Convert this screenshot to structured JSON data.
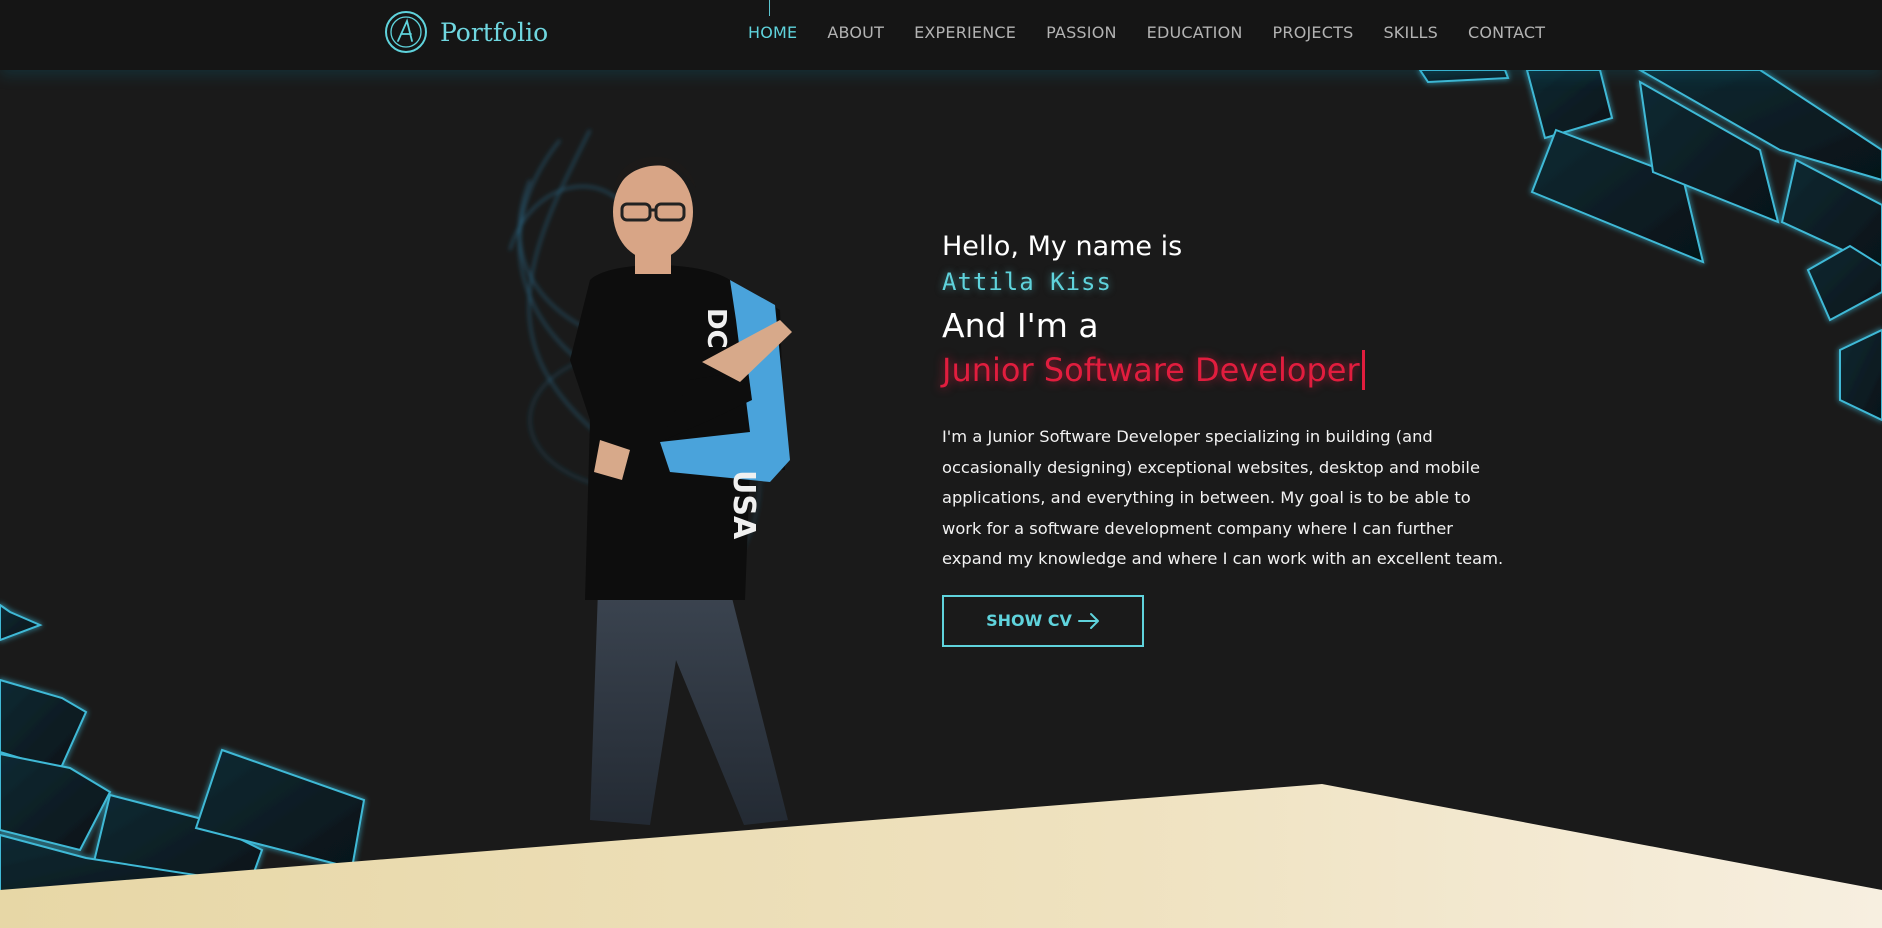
{
  "nav": {
    "logo_text": "Portfolio",
    "links": [
      {
        "label": "HOME",
        "active": true
      },
      {
        "label": "ABOUT"
      },
      {
        "label": "EXPERIENCE"
      },
      {
        "label": "PASSION"
      },
      {
        "label": "EDUCATION"
      },
      {
        "label": "PROJECTS"
      },
      {
        "label": "SKILLS"
      },
      {
        "label": "CONTACT"
      }
    ]
  },
  "hero": {
    "greeting": "Hello, My name is",
    "name": "Attila Kiss",
    "intro": "And I'm a",
    "role": "Junior Software Developer",
    "bio": "I'm a Junior Software Developer specializing in building (and occasionally designing) exceptional websites, desktop and mobile applications, and everything in between. My goal is to be able to work for a software development company where I can further expand my knowledge and where I can work with an excellent team.",
    "cv_button": "SHOW CV"
  },
  "icons": {
    "logo": "monogram-a-icon",
    "cv_button": "arrow-right-icon"
  },
  "colors": {
    "background": "#1a1a1a",
    "nav_background": "#151515",
    "accent": "#5fd3dc",
    "role_red": "#e11d3e",
    "band_cream": "#ecdfb9"
  }
}
